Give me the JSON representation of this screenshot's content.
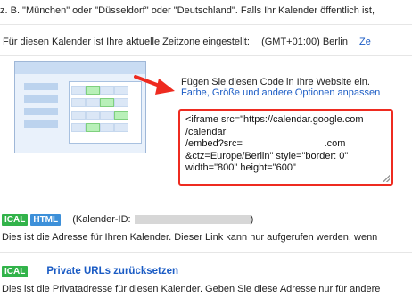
{
  "intro": {
    "text": "z. B. \"München\" oder \"Düsseldorf\" oder \"Deutschland\". Falls Ihr Kalender öffentlich ist,"
  },
  "timezone": {
    "label": "Für diesen Kalender ist Ihre aktuelle Zeitzone eingestellt:",
    "value": "(GMT+01:00) Berlin",
    "link": "Ze"
  },
  "embed": {
    "intro": "Fügen Sie diesen Code in Ihre Website ein.",
    "link": "Farbe, Größe und andere Optionen anpassen",
    "code": "<iframe src=\"https://calendar.google.com\n/calendar\n/embed?src=                              .com\n&ctz=Europe/Berlin\" style=\"border: 0\"\nwidth=\"800\" height=\"600\""
  },
  "public_address": {
    "badge_ical": "ICAL",
    "badge_html": "HTML",
    "calendar_id_label": "(Kalender-ID:",
    "calendar_id_close": ")",
    "description": "Dies ist die Adresse für Ihren Kalender. Dieser Link kann nur aufgerufen werden, wenn"
  },
  "private_address": {
    "badge_ical": "ICAL",
    "reset_link": "Private URLs zurücksetzen",
    "description": "Dies ist die Privatadresse für diesen Kalender. Geben Sie diese Adresse nur für andere"
  },
  "colors": {
    "highlight_red": "#ee2b20",
    "link_blue": "#1a5bc4",
    "ical_green": "#32b34a",
    "html_blue": "#3d90d9"
  }
}
